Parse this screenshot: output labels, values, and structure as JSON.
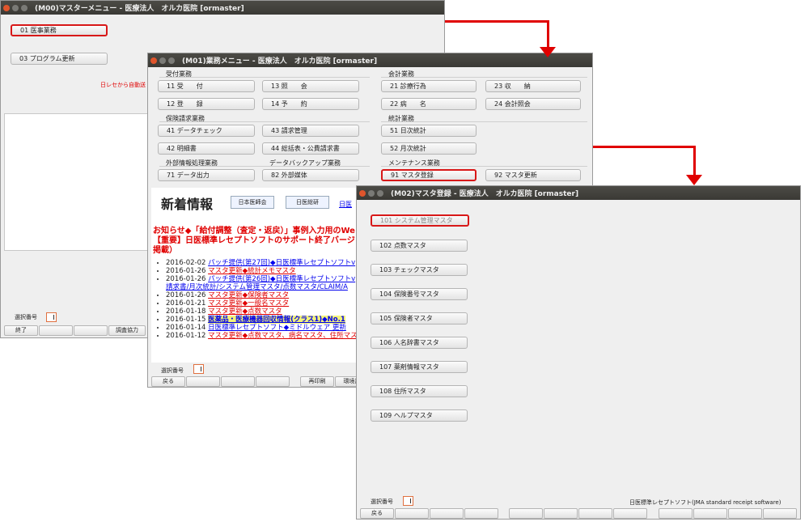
{
  "win_m00": {
    "title": "(M00)マスターメニュー - 医療法人　オルカ医院 [ormaster]",
    "buttons": [
      "01 医事業務",
      "03 プログラム更新"
    ],
    "red_notice": "日レセから自動送",
    "select_label": "選択番号",
    "footer": [
      "終了",
      "",
      "",
      "調査協力"
    ]
  },
  "win_m01": {
    "title": "(M01)業務メニュー - 医療法人　オルカ医院 [ormaster]",
    "groups": {
      "uketsuke": "受付業務",
      "kaikei": "会計業務",
      "hoken": "保険請求業務",
      "toukei": "統計業務",
      "gaibu": "外部情報処理業務",
      "backup": "データバックアップ業務",
      "maint": "メンテナンス業務"
    },
    "buttons": {
      "b11": "11 受　　付",
      "b13": "13 照　　会",
      "b21": "21 診療行為",
      "b23": "23 収　　納",
      "b12": "12 登　　録",
      "b14": "14 予　　約",
      "b22": "22 病　　名",
      "b24": "24 会計照会",
      "b41": "41 データチェック",
      "b43": "43 請求管理",
      "b51": "51 日次統計",
      "b42": "42 明細書",
      "b44": "44 総括表・公費請求書",
      "b52": "52 月次統計",
      "b71": "71 データ出力",
      "b82": "82 外部媒体",
      "b91": "91 マスタ登録",
      "b92": "92 マスタ更新"
    },
    "news": {
      "title": "新着情報",
      "tab1": "日本医師会",
      "tab2": "日医総研",
      "tab3": "日医",
      "red1": "お知らせ◆「給付調整（査定・返戻）」事例入力用のWe",
      "red2": "【重要】日医標準レセプトソフトのサポート終了バージョ",
      "red3": "掲載）",
      "items": [
        {
          "date": "2016-02-02",
          "text": "パッチ提供(第27回)◆日医標準レセプトソフトv"
        },
        {
          "date": "2016-01-26",
          "text": "マスタ更新◆統計メモマスタ"
        },
        {
          "date": "2016-01-26",
          "text": "パッチ提供(第26回)◆日医標準レセプトソフトv"
        },
        {
          "date": "",
          "text": "請求書/月次統計/システム管理マスタ/点数マスタ/CLAIM/A"
        },
        {
          "date": "2016-01-26",
          "text": "マスタ更新◆保険者マスタ"
        },
        {
          "date": "2016-01-21",
          "text": "マスタ更新◆一般名マスタ"
        },
        {
          "date": "2016-01-18",
          "text": "マスタ更新◆点数マスタ"
        },
        {
          "date": "2016-01-15",
          "text": "医薬品・医療機器回収情報(クラス1)◆No.1"
        },
        {
          "date": "2016-01-14",
          "text": "日医標準レセプトソフト◆ミドルウェア 更新"
        },
        {
          "date": "2016-01-12",
          "text": "マスタ更新◆点数マスタ、病名マスタ、住所マスタ"
        }
      ]
    },
    "select_label": "選択番号",
    "footer": [
      "戻る",
      "",
      "",
      "",
      "再印刷",
      "環境設"
    ]
  },
  "win_m02": {
    "title": "(M02)マスタ登録 - 医療法人　オルカ医院 [ormaster]",
    "buttons": [
      "101 システム管理マスタ",
      "102 点数マスタ",
      "103 チェックマスタ",
      "104 保険番号マスタ",
      "105 保険者マスタ",
      "106 人名辞書マスタ",
      "107 薬剤情報マスタ",
      "108 住所マスタ",
      "109 ヘルプマスタ"
    ],
    "select_label": "選択番号",
    "status": "日医標準レセプトソフト(JMA standard receipt software)",
    "footer": [
      "戻る",
      "",
      "",
      "",
      "",
      "",
      "",
      "",
      "",
      "",
      "",
      ""
    ]
  },
  "colors": {
    "highlight_border": "#d81818",
    "arrow": "#e00000",
    "titlebar": "#3c3b37"
  }
}
